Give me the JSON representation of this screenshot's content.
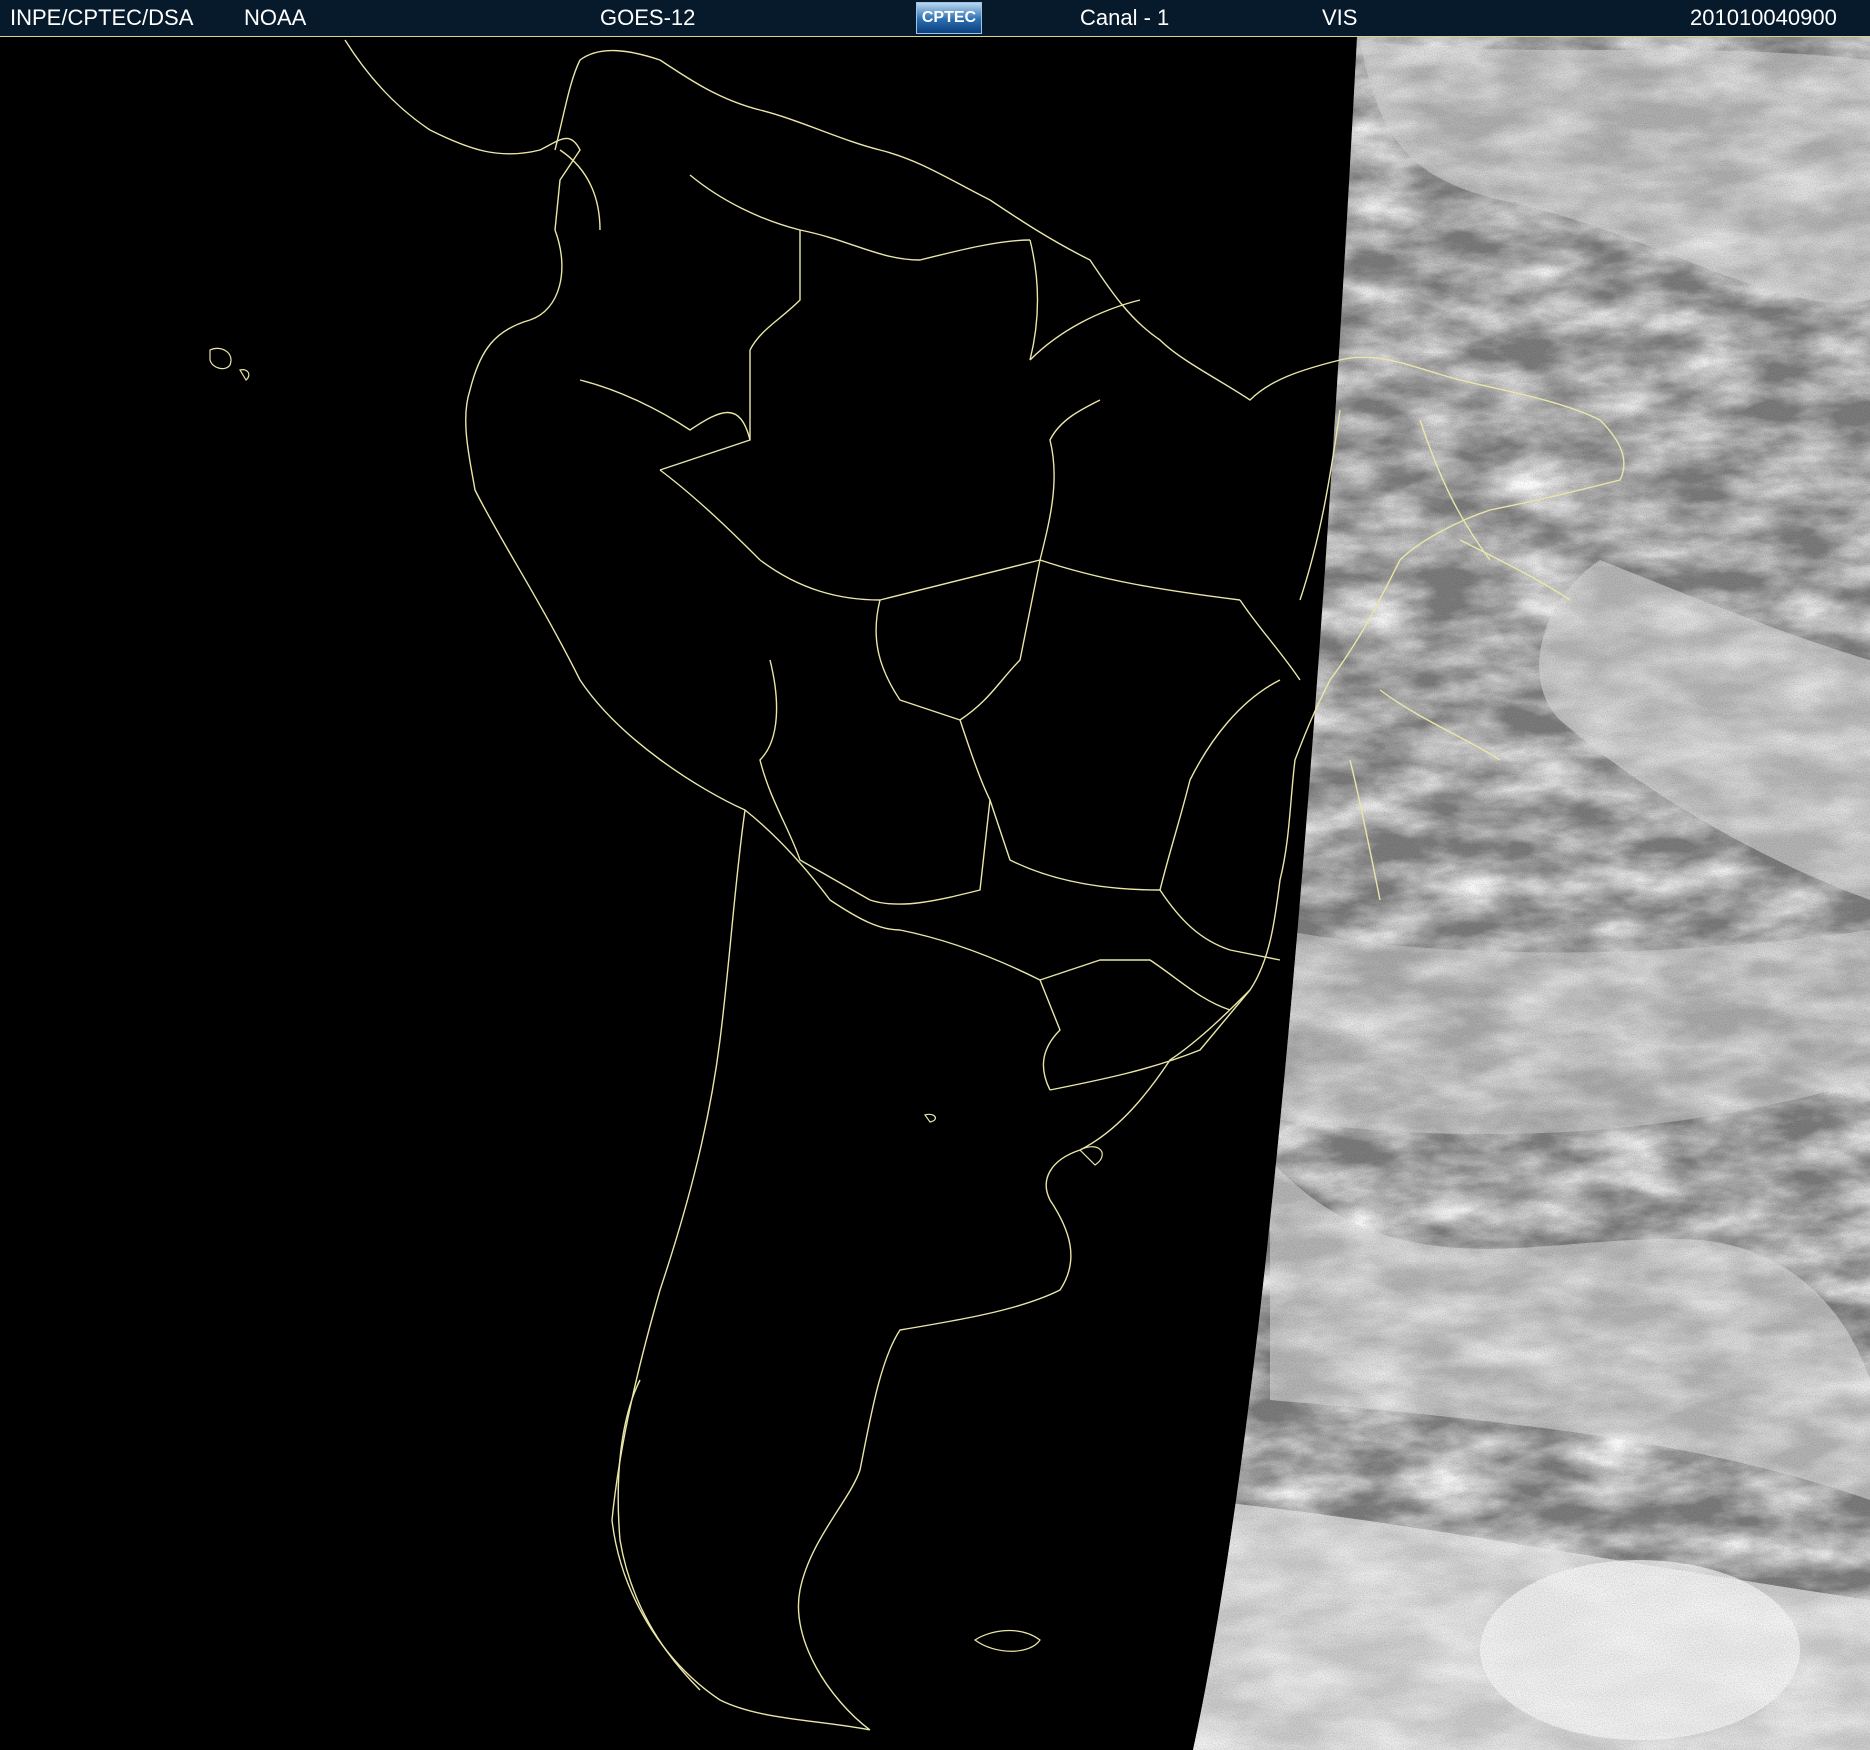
{
  "header": {
    "org": "INPE/CPTEC/DSA",
    "agency": "NOAA",
    "satellite": "GOES-12",
    "logo_text": "CPTEC",
    "channel": "Canal - 1",
    "band": "VIS",
    "timestamp": "201010040900"
  },
  "colors": {
    "header_bg": "#071a2b",
    "border_lines": "#e9e6a8",
    "night_side": "#000000",
    "cloud_gray": "#8a8a8a",
    "cloud_white": "#f0f0f0"
  },
  "map": {
    "region": "South America",
    "image_type": "visible satellite",
    "night_terminator": "diagonal"
  }
}
